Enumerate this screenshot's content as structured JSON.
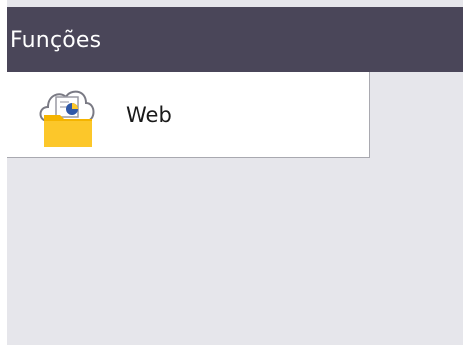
{
  "header": {
    "title": "Funções"
  },
  "functions": [
    {
      "label": "Web",
      "icon": "web-folder-cloud-icon"
    }
  ],
  "colors": {
    "header_bg": "#4a4659",
    "screen_bg": "#e6e6eb",
    "folder": "#fcc72a",
    "chart_blue": "#2f58a8"
  }
}
